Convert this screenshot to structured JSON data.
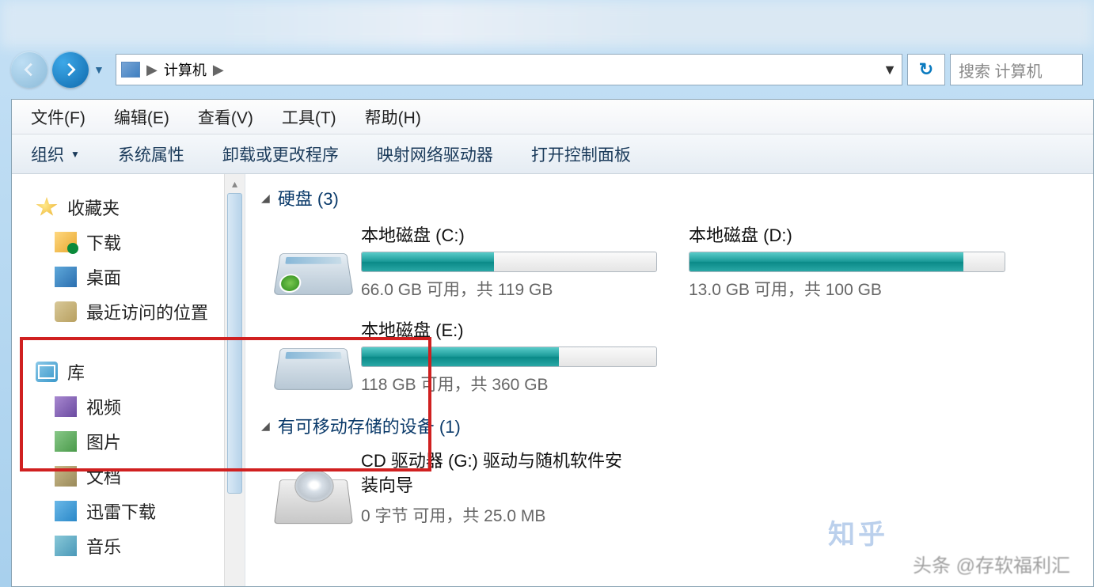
{
  "breadcrumb": {
    "location": "计算机"
  },
  "search": {
    "placeholder": "搜索 计算机"
  },
  "menu": {
    "file": "文件(F)",
    "edit": "编辑(E)",
    "view": "查看(V)",
    "tools": "工具(T)",
    "help": "帮助(H)"
  },
  "toolbar": {
    "organize": "组织",
    "props": "系统属性",
    "uninstall": "卸载或更改程序",
    "map": "映射网络驱动器",
    "cpanel": "打开控制面板"
  },
  "sidebar": {
    "favorites": "收藏夹",
    "downloads": "下载",
    "desktop": "桌面",
    "recent": "最近访问的位置",
    "libraries": "库",
    "videos": "视频",
    "pictures": "图片",
    "documents": "文档",
    "thunder": "迅雷下载",
    "music": "音乐"
  },
  "groups": {
    "hdd": "硬盘 (3)",
    "removable": "有可移动存储的设备 (1)"
  },
  "drives": {
    "c": {
      "name": "本地磁盘 (C:)",
      "free": "66.0 GB 可用，共 119 GB",
      "pct": 45
    },
    "d": {
      "name": "本地磁盘 (D:)",
      "free": "13.0 GB 可用，共 100 GB",
      "pct": 87
    },
    "e": {
      "name": "本地磁盘 (E:)",
      "free": "118 GB 可用，共 360 GB",
      "pct": 67
    },
    "g": {
      "name": "CD 驱动器 (G:) 驱动与随机软件安装向导",
      "free": "0 字节 可用，共 25.0 MB"
    }
  },
  "watermark": {
    "zh": "知乎",
    "src": "头条 @存软福利汇"
  }
}
